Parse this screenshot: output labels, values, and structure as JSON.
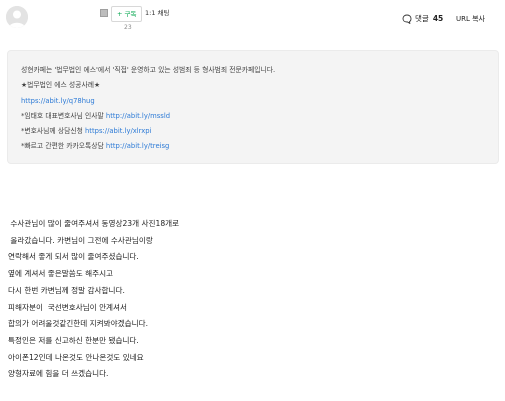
{
  "header": {
    "subscribe_label": "+ 구독",
    "chat_label": "1:1 채팅",
    "view_count": "23",
    "comment_label": "댓글",
    "comment_count": "45",
    "url_copy_label": "URL 복사"
  },
  "notice": {
    "line1": "성현카페는 '법무법인 에스'에서 '직접' 운영하고 있는 성범죄 등 형사범죄 전문카페입니다.",
    "line2": "★법무법인 에스 성공사례★",
    "line3_link": "https://abit.ly/q78hug",
    "line4_text": "*임태호 대표변호사님 인사말 ",
    "line4_link": "http://abit.ly/mssld",
    "line5_text": "*변호사님께 상담신청 ",
    "line5_link": "https://abit.ly/xlrxpi",
    "line6_text": "*빠르고 간편한 카카오톡상담 ",
    "line6_link": "http://abit.ly/treisg"
  },
  "content": {
    "lines": [
      " 수사관님이 많이 줄여주셔서 동영상23개 사진18개로",
      " 올라갔습니다. 카변님이 그전에 수사관님이랑",
      "연락해서 좋게 되서 많이 줄여주셨습니다.",
      "옆에 계셔서 좋은말씀도 해주시고",
      "다시 한번 카변님께 정말 감사합니다.",
      "피해자분이  국선변호사님이 안계셔서",
      "합의가 어려울것같긴한데 지켜봐야겠습니다.",
      "특정인은 저를 신고하신 한분만 됐습니다.",
      "아이폰12인데 나온것도 안나온것도 있네요",
      "양형자료에 힘을 더 쓰겠습니다."
    ]
  },
  "colors": {
    "accent_green": "#00a44b",
    "link_blue": "#2c7ad6",
    "notice_bg": "#f4f4f4"
  }
}
